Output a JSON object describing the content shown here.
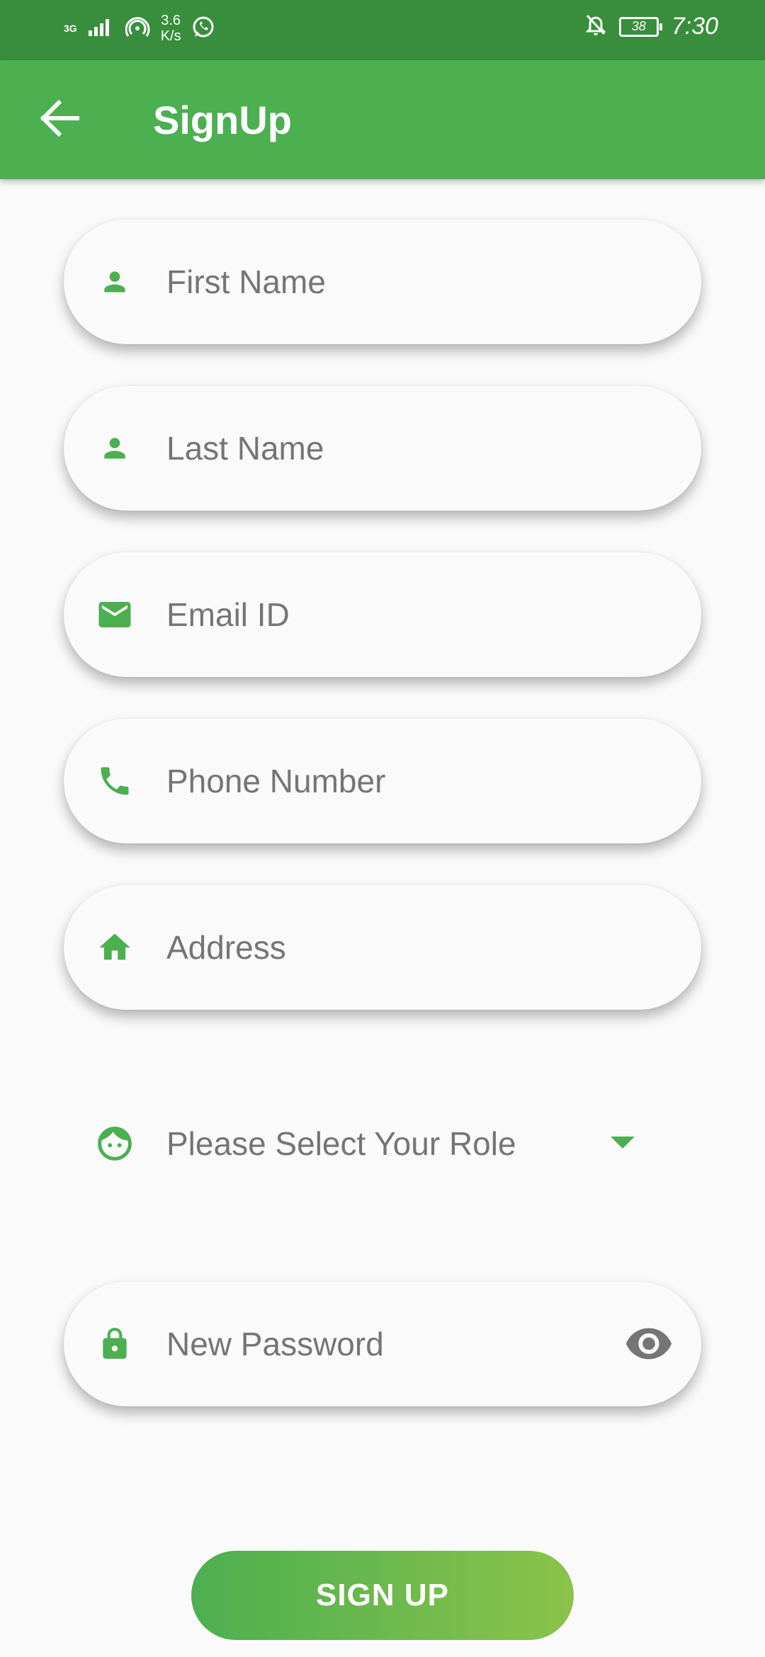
{
  "status_bar": {
    "network_type": "3G",
    "speed_value": "3.6",
    "speed_unit": "K/s",
    "battery": "38",
    "time": "7:30"
  },
  "app_bar": {
    "title": "SignUp",
    "back_icon": "arrow-back-icon"
  },
  "form": {
    "first_name": {
      "placeholder": "First Name",
      "icon": "person-icon"
    },
    "last_name": {
      "placeholder": "Last Name",
      "icon": "person-icon"
    },
    "email": {
      "placeholder": "Email ID",
      "icon": "mail-icon"
    },
    "phone": {
      "placeholder": "Phone Number",
      "icon": "phone-icon"
    },
    "address": {
      "placeholder": "Address",
      "icon": "home-icon"
    },
    "role": {
      "placeholder": "Please Select Your Role",
      "icon": "face-icon"
    },
    "password": {
      "placeholder": "New Password",
      "icon": "lock-icon",
      "toggle_icon": "eye-icon"
    }
  },
  "signup_button": {
    "label": "SIGN UP"
  },
  "colors": {
    "primary": "#4caf50",
    "primary_dark": "#388e3c",
    "gradient_end": "#8bc34a",
    "placeholder_text": "#757575",
    "background": "#fafafa"
  }
}
